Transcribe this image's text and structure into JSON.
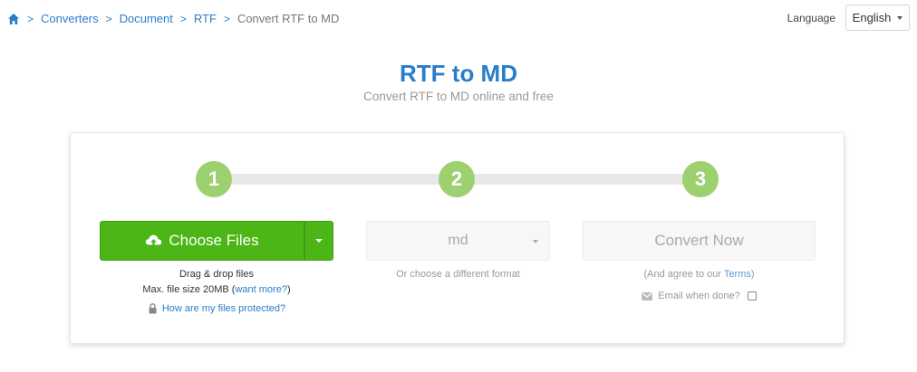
{
  "breadcrumb": {
    "home_icon": "home-icon",
    "separator": ">",
    "items": [
      "Converters",
      "Document",
      "RTF"
    ],
    "current": "Convert RTF to MD"
  },
  "language": {
    "label": "Language",
    "selected": "English"
  },
  "header": {
    "title": "RTF to MD",
    "subtitle": "Convert RTF to MD online and free"
  },
  "steps": [
    "1",
    "2",
    "3"
  ],
  "upload": {
    "button_label": "Choose Files",
    "drag_text": "Drag & drop files",
    "max_size_prefix": "Max. file size 20MB (",
    "want_more": "want more?",
    "max_size_suffix": ")",
    "protected_link": "How are my files protected?"
  },
  "format": {
    "selected": "md",
    "hint": "Or choose a different format"
  },
  "convert": {
    "button_label": "Convert Now",
    "agree_prefix": "(And agree to our ",
    "terms": "Terms",
    "agree_suffix": ")",
    "email_label": "Email when done?"
  },
  "colors": {
    "accent_blue": "#2a7dc9",
    "primary_green": "#4cb616",
    "step_green": "#9dd06e"
  }
}
